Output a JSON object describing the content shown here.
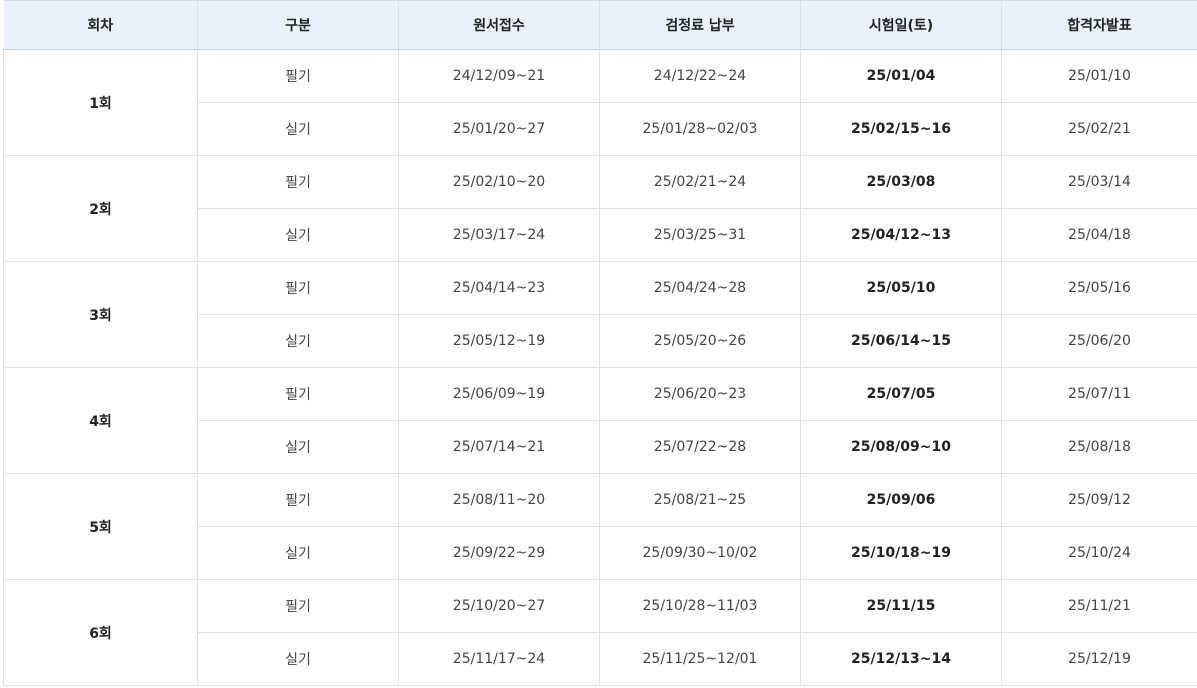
{
  "headers": [
    "회차",
    "구분",
    "원서접수",
    "검정료 납부",
    "시험일(토)",
    "합격자발표"
  ],
  "rounds": [
    {
      "label": "1회",
      "rows": [
        {
          "type": "필기",
          "application": "24/12/09~21",
          "fee": "24/12/22~24",
          "exam": "25/01/04",
          "result": "25/01/10"
        },
        {
          "type": "실기",
          "application": "25/01/20~27",
          "fee": "25/01/28~02/03",
          "exam": "25/02/15~16",
          "result": "25/02/21"
        }
      ]
    },
    {
      "label": "2회",
      "rows": [
        {
          "type": "필기",
          "application": "25/02/10~20",
          "fee": "25/02/21~24",
          "exam": "25/03/08",
          "result": "25/03/14"
        },
        {
          "type": "실기",
          "application": "25/03/17~24",
          "fee": "25/03/25~31",
          "exam": "25/04/12~13",
          "result": "25/04/18"
        }
      ]
    },
    {
      "label": "3회",
      "rows": [
        {
          "type": "필기",
          "application": "25/04/14~23",
          "fee": "25/04/24~28",
          "exam": "25/05/10",
          "result": "25/05/16"
        },
        {
          "type": "실기",
          "application": "25/05/12~19",
          "fee": "25/05/20~26",
          "exam": "25/06/14~15",
          "result": "25/06/20"
        }
      ]
    },
    {
      "label": "4회",
      "rows": [
        {
          "type": "필기",
          "application": "25/06/09~19",
          "fee": "25/06/20~23",
          "exam": "25/07/05",
          "result": "25/07/11"
        },
        {
          "type": "실기",
          "application": "25/07/14~21",
          "fee": "25/07/22~28",
          "exam": "25/08/09~10",
          "result": "25/08/18"
        }
      ]
    },
    {
      "label": "5회",
      "rows": [
        {
          "type": "필기",
          "application": "25/08/11~20",
          "fee": "25/08/21~25",
          "exam": "25/09/06",
          "result": "25/09/12"
        },
        {
          "type": "실기",
          "application": "25/09/22~29",
          "fee": "25/09/30~10/02",
          "exam": "25/10/18~19",
          "result": "25/10/24"
        }
      ]
    },
    {
      "label": "6회",
      "rows": [
        {
          "type": "필기",
          "application": "25/10/20~27",
          "fee": "25/10/28~11/03",
          "exam": "25/11/15",
          "result": "25/11/21"
        },
        {
          "type": "실기",
          "application": "25/11/17~24",
          "fee": "25/11/25~12/01",
          "exam": "25/12/13~14",
          "result": "25/12/19"
        }
      ]
    }
  ],
  "colors": {
    "header_bg": "#e9f2fc",
    "border": "#e1e1e1",
    "text": "#444444",
    "strong_text": "#222222"
  }
}
